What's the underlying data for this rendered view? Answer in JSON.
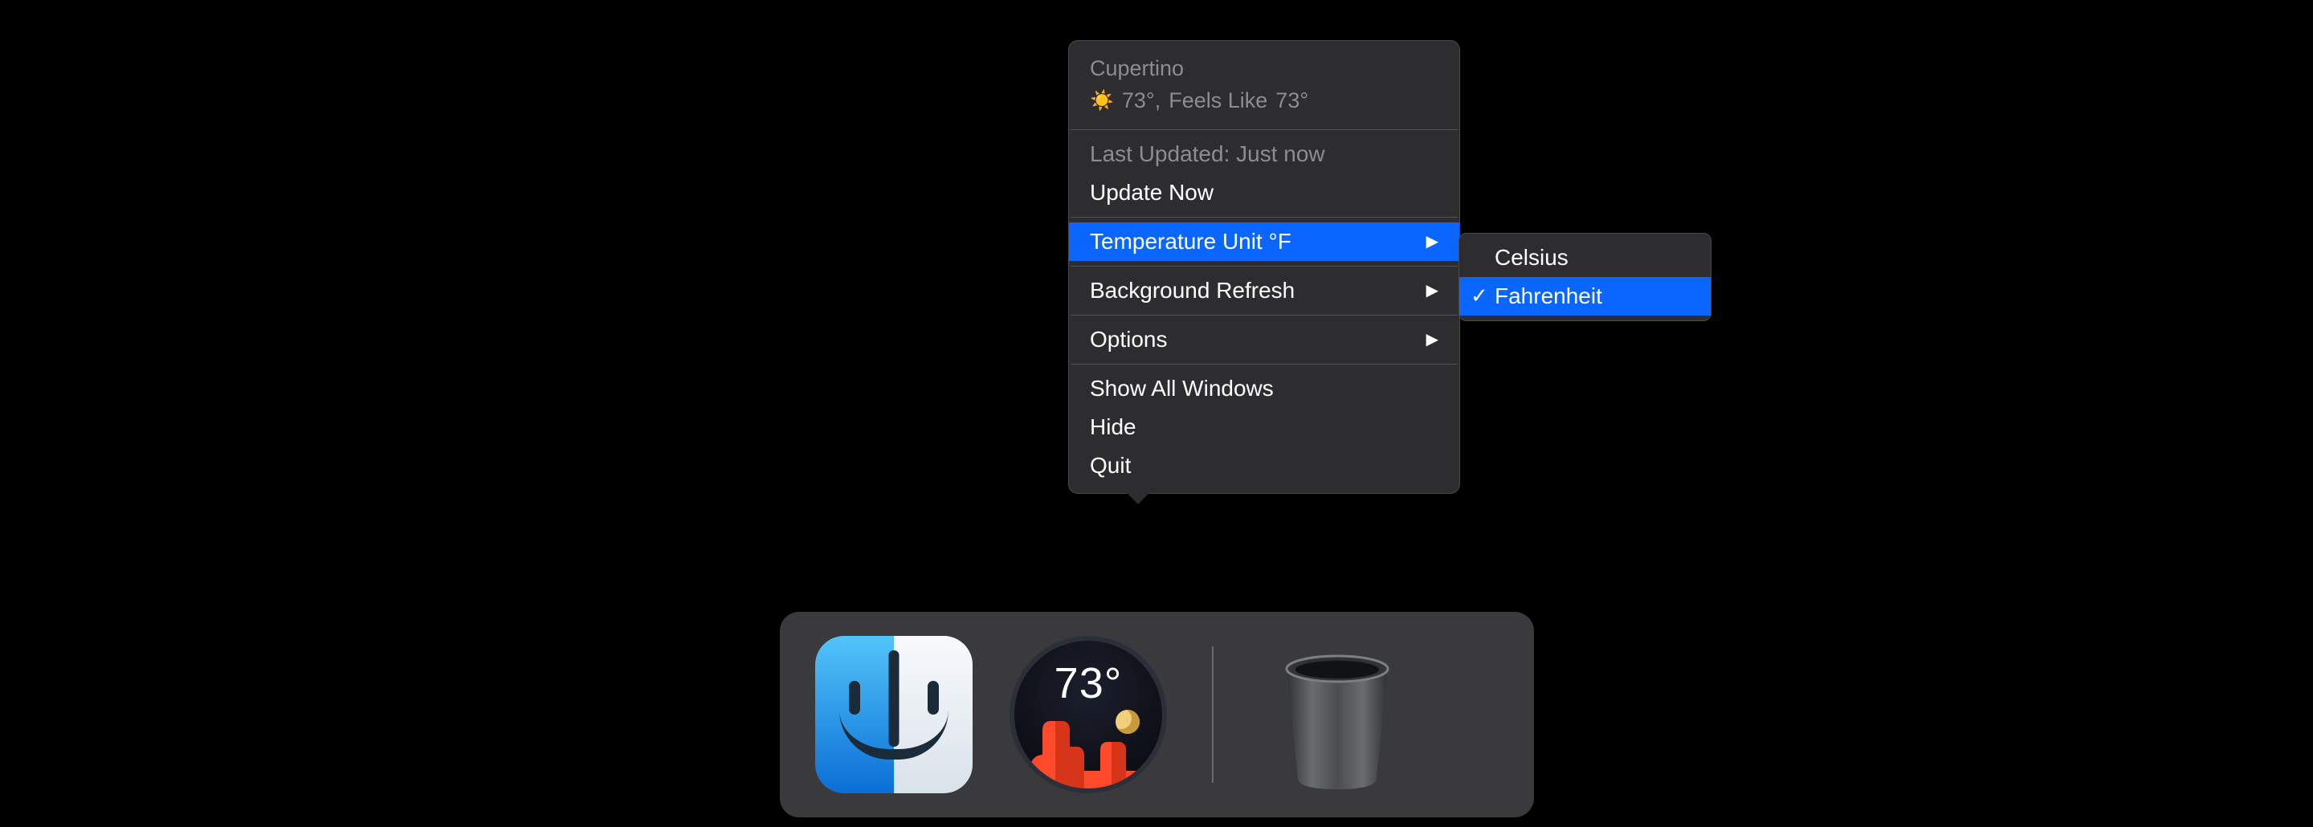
{
  "weather": {
    "location": "Cupertino",
    "icon": "sun-icon",
    "current_temp": "73°,",
    "feels_like_label": "Feels Like",
    "feels_like_temp": "73°"
  },
  "menu": {
    "last_updated_label": "Last Updated: Just now",
    "update_now": "Update Now",
    "temperature_unit_label": "Temperature Unit °F",
    "background_refresh": "Background Refresh",
    "options": "Options",
    "show_all_windows": "Show All Windows",
    "hide": "Hide",
    "quit": "Quit"
  },
  "submenu": {
    "celsius": "Celsius",
    "fahrenheit": "Fahrenheit",
    "selected": "fahrenheit"
  },
  "dock": {
    "weather_temp": "73°"
  }
}
